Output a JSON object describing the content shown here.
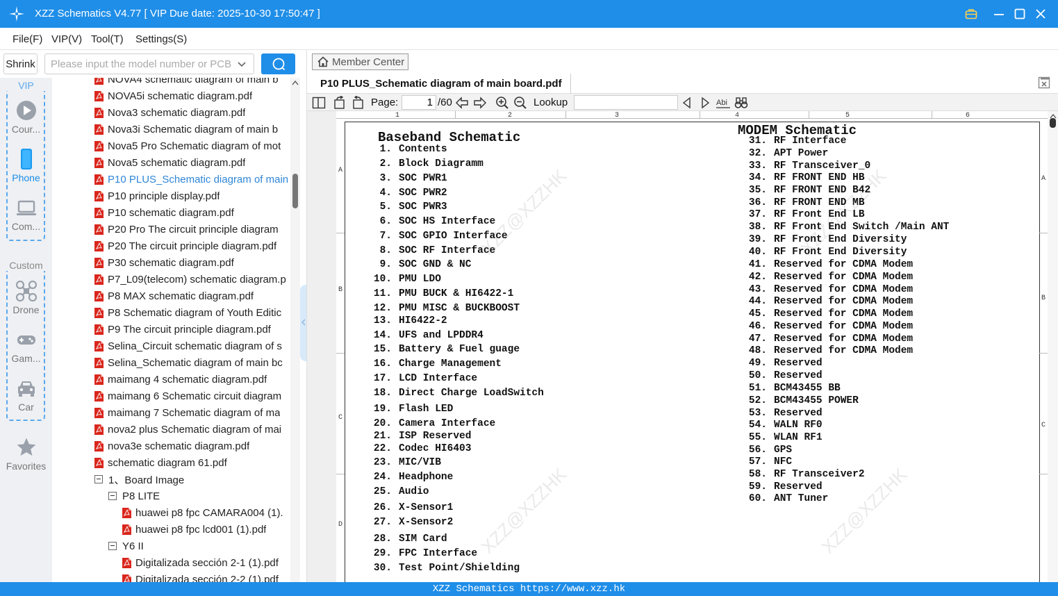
{
  "window": {
    "title": "XZZ Schematics V4.77 [ VIP Due date: 2025-10-30 17:50:47 ]"
  },
  "menu": [
    "File(F)",
    "VIP(V)",
    "Tool(T)",
    "Settings(S)"
  ],
  "search": {
    "shrink_label": "Shrink",
    "placeholder": "Please input the model number or PCB"
  },
  "nav": {
    "vip_group_label": "VIP",
    "custom_group_label": "Custom",
    "items": [
      {
        "label": "Cour...",
        "icon": "play-circle-icon",
        "active": false
      },
      {
        "label": "Phone",
        "icon": "phone-icon",
        "active": true
      },
      {
        "label": "Com...",
        "icon": "laptop-icon",
        "active": false
      },
      {
        "label": "Drone",
        "icon": "drone-icon",
        "active": false
      },
      {
        "label": "Gam...",
        "icon": "gamepad-icon",
        "active": false
      },
      {
        "label": "Car",
        "icon": "car-icon",
        "active": false
      },
      {
        "label": "Favorites",
        "icon": "star-icon",
        "active": false
      }
    ]
  },
  "tree": {
    "files": [
      "NOVA4 schematic diagram of main b",
      "NOVA5i schematic diagram.pdf",
      "Nova3 schematic diagram.pdf",
      "Nova3i Schematic diagram of main b",
      "Nova5 Pro Schematic diagram of mot",
      "Nova5 schematic diagram.pdf",
      "P10 PLUS_Schematic diagram of main",
      "P10 principle display.pdf",
      "P10 schematic diagram.pdf",
      "P20 Pro The circuit principle diagram",
      "P20 The circuit principle diagram.pdf",
      "P30 schematic diagram.pdf",
      "P7_L09(telecom) schematic diagram.p",
      "P8 MAX schematic diagram.pdf",
      "P8 Schematic diagram of Youth Editic",
      "P9 The circuit principle diagram.pdf",
      "Selina_Circuit schematic diagram of s",
      "Selina_Schematic diagram of main bc",
      "maimang 4 schematic diagram.pdf",
      "maimang 6 Schematic circuit diagram",
      "maimang 7 Schematic diagram of ma",
      "nova2 plus Schematic diagram of mai",
      "nova3e schematic diagram.pdf",
      "schematic diagram 61.pdf"
    ],
    "selected_index": 6,
    "board_image_folder": "1、Board Image",
    "sub_folders": [
      {
        "name": "P8 LITE",
        "files": [
          "huawei p8 fpc CAMARA004 (1).",
          "huawei p8 fpc lcd001 (1).pdf"
        ]
      },
      {
        "name": "Y6 II",
        "files": [
          "Digitalizada sección 2-1 (1).pdf",
          "Digitalizada sección 2-2 (1).pdf"
        ]
      }
    ]
  },
  "viewer": {
    "member_center_label": "Member Center",
    "tab_title": "P10 PLUS_Schematic diagram of main board.pdf",
    "page_label": "Page:",
    "page_current": "1",
    "page_total": "/60",
    "lookup_label": "Lookup",
    "column_numbers": [
      "1",
      "2",
      "3",
      "4",
      "5",
      "6"
    ],
    "row_letters": [
      "A",
      "B",
      "C",
      "D"
    ],
    "watermark": "XZZ@XZZHK",
    "baseband": {
      "title": "Baseband Schematic",
      "entries": [
        [
          "1.",
          "Contents"
        ],
        [
          "2.",
          "Block Diagramm"
        ],
        [
          "3.",
          "SOC PWR1"
        ],
        [
          "4.",
          "SOC PWR2"
        ],
        [
          "5.",
          "SOC PWR3"
        ],
        [
          "6.",
          "SOC HS Interface"
        ],
        [
          "7.",
          "SOC GPIO Interface"
        ],
        [
          "8.",
          "SOC RF Interface"
        ],
        [
          "9.",
          "SOC GND & NC"
        ],
        [
          "10.",
          "PMU LDO"
        ],
        [
          "11.",
          "PMU BUCK & HI6422-1"
        ],
        [
          "12.",
          "PMU MISC & BUCKBOOST"
        ],
        [
          "13.",
          "HI6422-2"
        ],
        [
          "14.",
          "UFS and LPDDR4"
        ],
        [
          "15.",
          "Battery & Fuel guage"
        ],
        [
          "16.",
          "Charge Management"
        ],
        [
          "17.",
          "LCD Interface"
        ],
        [
          "18.",
          "Direct Charge LoadSwitch"
        ],
        [
          "19.",
          "Flash LED"
        ],
        [
          "20.",
          "Camera Interface"
        ],
        [
          "21.",
          "ISP Reserved"
        ],
        [
          "22.",
          "Codec HI6403"
        ],
        [
          "23.",
          "MIC/VIB"
        ],
        [
          "24.",
          "Headphone"
        ],
        [
          "25.",
          "Audio"
        ],
        [
          "26.",
          "X-Sensor1"
        ],
        [
          "27.",
          "X-Sensor2"
        ],
        [
          "28.",
          "SIM Card"
        ],
        [
          "29.",
          "FPC Interface"
        ],
        [
          "30.",
          "Test Point/Shielding"
        ]
      ]
    },
    "modem": {
      "title": "MODEM Schematic",
      "entries": [
        [
          "31.",
          "RF Interface"
        ],
        [
          "32.",
          "APT Power"
        ],
        [
          "33.",
          "RF Transceiver_0"
        ],
        [
          "34.",
          "RF FRONT END HB"
        ],
        [
          "35.",
          "RF FRONT END B42"
        ],
        [
          "36.",
          "RF FRONT END MB"
        ],
        [
          "37.",
          "RF Front End LB"
        ],
        [
          "38.",
          "RF Front End Switch /Main ANT"
        ],
        [
          "39.",
          "RF Front End Diversity"
        ],
        [
          "40.",
          "RF Front End Diversity"
        ],
        [
          "41.",
          "Reserved for CDMA Modem"
        ],
        [
          "42.",
          "Reserved for CDMA Modem"
        ],
        [
          "43.",
          "Reserved for CDMA Modem"
        ],
        [
          "44.",
          "Reserved for CDMA Modem"
        ],
        [
          "45.",
          "Reserved for CDMA Modem"
        ],
        [
          "46.",
          "Reserved for CDMA Modem"
        ],
        [
          "47.",
          "Reserved for CDMA Modem"
        ],
        [
          "48.",
          "Reserved for CDMA Modem"
        ],
        [
          "49.",
          "Reserved"
        ],
        [
          "50.",
          "Reserved"
        ],
        [
          "51.",
          "BCM43455 BB"
        ],
        [
          "52.",
          "BCM43455 POWER"
        ],
        [
          "53.",
          "Reserved"
        ],
        [
          "54.",
          "WALN RF0"
        ],
        [
          "55.",
          "WLAN RF1"
        ],
        [
          "56.",
          "GPS"
        ],
        [
          "57.",
          "NFC"
        ],
        [
          "58.",
          "RF Transceiver2"
        ],
        [
          "59.",
          "Reserved"
        ],
        [
          "60.",
          "ANT Tuner"
        ]
      ]
    }
  },
  "status_bar": "XZZ Schematics https://www.xzz.hk",
  "colors": {
    "accent": "#1f8ee8",
    "selected_text": "#2e86d8",
    "pdf_icon": "#d9261c",
    "nav_bg": "#eef0f3"
  }
}
